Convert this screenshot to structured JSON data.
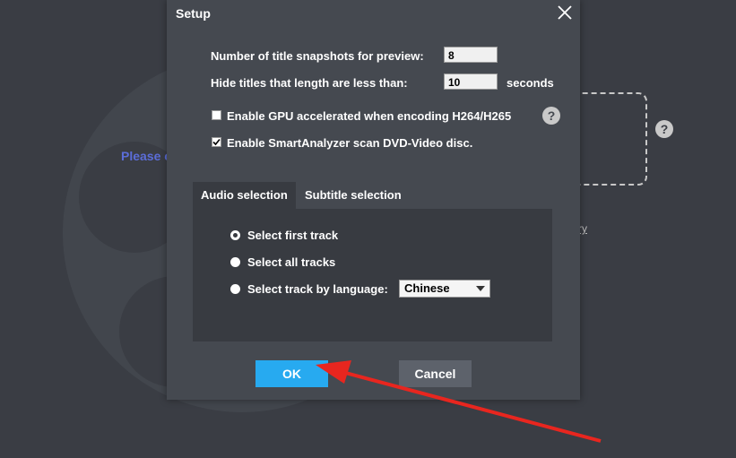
{
  "background": {
    "prompt_text": "Please c",
    "help_icon": "?",
    "link_text": "ry"
  },
  "dialog": {
    "title": "Setup",
    "snapshots_label": "Number of title snapshots for preview:",
    "snapshots_value": "8",
    "hide_label": "Hide titles that length are less than:",
    "hide_value": "10",
    "hide_unit": "seconds",
    "gpu_label": "Enable GPU accelerated when encoding H264/H265",
    "gpu_checked": false,
    "smart_label": "Enable SmartAnalyzer scan DVD-Video disc.",
    "smart_checked": true,
    "help_icon": "?",
    "tabs": [
      {
        "label": "Audio selection",
        "active": true
      },
      {
        "label": "Subtitle selection",
        "active": false
      }
    ],
    "options": [
      {
        "label": "Select first track",
        "selected": true
      },
      {
        "label": "Select all tracks",
        "selected": false
      },
      {
        "label": "Select track by language:",
        "selected": false
      }
    ],
    "language_value": "Chinese",
    "ok_label": "OK",
    "cancel_label": "Cancel",
    "colors": {
      "ok": "#27aaf0",
      "arrow": "#e8261f"
    }
  },
  "icons": {
    "close": "close-icon",
    "check": "checkmark-icon",
    "help": "question-icon",
    "dropdown": "chevron-down-icon",
    "annotation": "red-arrow"
  }
}
